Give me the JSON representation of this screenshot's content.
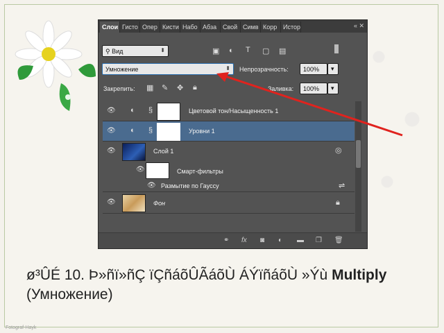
{
  "panel": {
    "tabs": [
      "Слои",
      "Гисто",
      "Опер",
      "Кисти",
      "Набо",
      "Абза",
      "Свой",
      "Симв",
      "Корр",
      "Истори"
    ],
    "tab_controls": "«  ✕",
    "filter": {
      "label": "Вид"
    },
    "blend_mode": "Умножение",
    "opacity": {
      "label": "Непрозрачность:",
      "value": "100%"
    },
    "lock": {
      "label": "Закрепить:"
    },
    "fill": {
      "label": "Заливка:",
      "value": "100%"
    },
    "layers": [
      {
        "name": "Цветовой тон/Насыщенность 1",
        "type": "adjustment"
      },
      {
        "name": "Уровни 1",
        "type": "adjustment",
        "selected": true
      },
      {
        "name": "Слой 1",
        "type": "smart-object"
      },
      {
        "name": "Смарт-фильтры",
        "type": "smart-filters"
      },
      {
        "name": "Размытие по Гауссу",
        "type": "filter"
      },
      {
        "name": "Фон",
        "type": "background"
      }
    ],
    "bottom_icons": [
      "link-icon",
      "fx-icon",
      "mask-icon",
      "adjustment-icon",
      "group-icon",
      "new-layer-icon",
      "trash-icon"
    ]
  },
  "caption": {
    "garbled": "ø³ÛÉ 10. Þ»ñï»ñÇ ïÇñáõÛÃáõÙ ÁÝïñáõÙ »Ýù ",
    "bold": "Multiply",
    "rest": " (Умножение)"
  },
  "footer": "Fotograf-Hayk",
  "colors": {
    "arrow": "#e0231e",
    "panel": "#535353",
    "selected_row": "#4a6b8f"
  }
}
